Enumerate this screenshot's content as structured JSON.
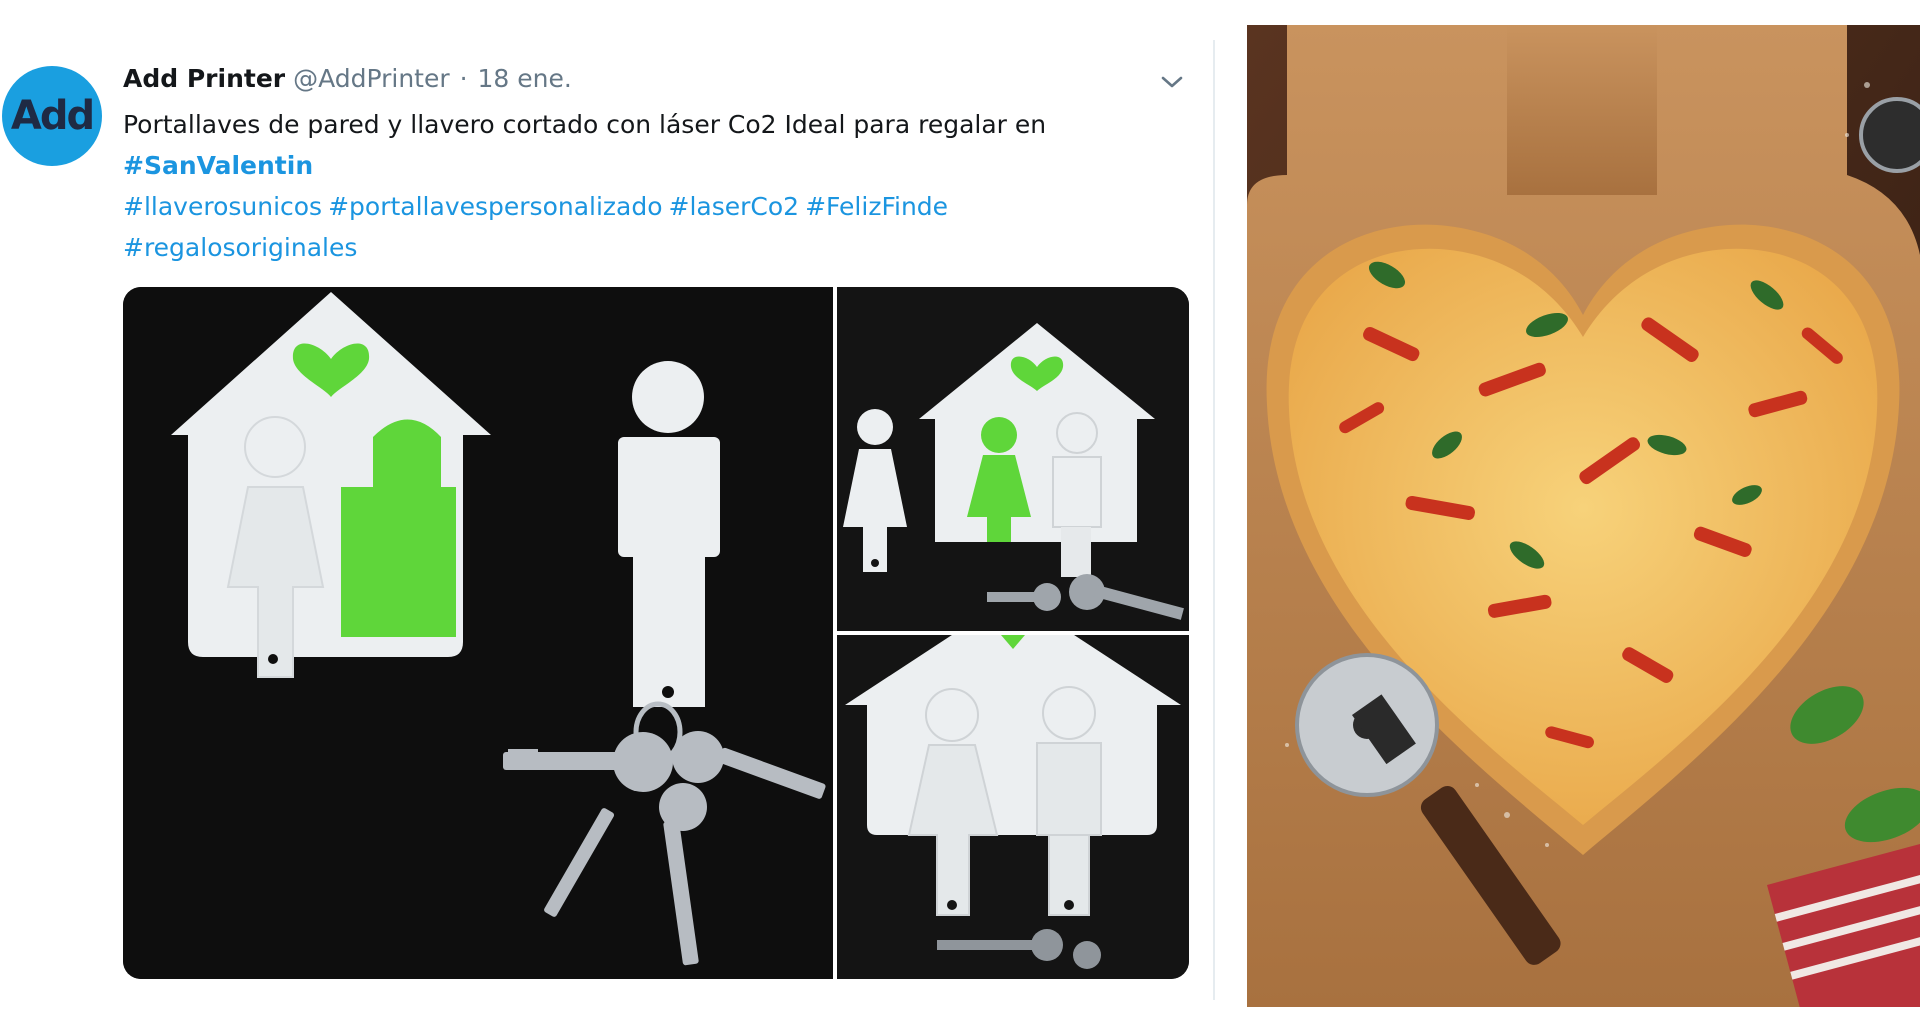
{
  "tweet": {
    "avatar_text": "Add",
    "author_name": "Add Printer",
    "author_handle": "@AddPrinter",
    "separator": "·",
    "date": "18 ene.",
    "text_line1": "Portallaves de pared y llavero cortado con láser Co2 Ideal para regalar en",
    "hashtag_main": "#SanValentin",
    "hashtags": [
      "#llaverosunicos",
      "#portallavespersonalizado",
      "#laserCo2",
      "#FelizFinde",
      "#regalosoriginales"
    ]
  },
  "colors": {
    "link": "#1b95e0",
    "avatar_bg": "#1a9fe0",
    "accent_green": "#5fd63a",
    "muted": "#657786"
  },
  "icons": {
    "menu": "chevron-down-icon"
  }
}
